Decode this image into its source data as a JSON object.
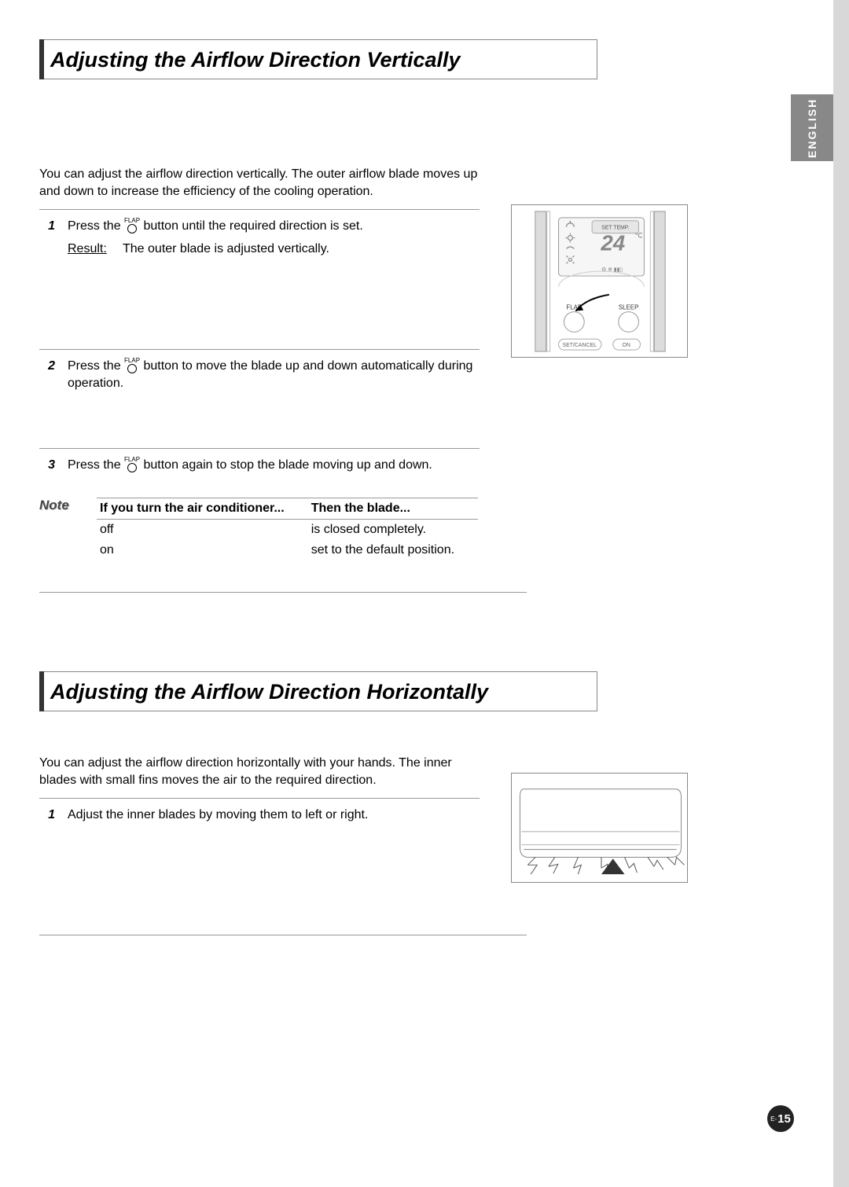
{
  "language_tab": "ENGLISH",
  "section1": {
    "title": "Adjusting the Airflow Direction Vertically",
    "intro": "You can adjust the airflow direction vertically. The outer airflow blade moves up and down to increase the efficiency of the cooling operation.",
    "steps": [
      {
        "num": "1",
        "pre": "Press the ",
        "icon": "FLAP",
        "post": " button until the required direction is set.",
        "result_label": "Result:",
        "result_text": "The outer blade is adjusted vertically."
      },
      {
        "num": "2",
        "pre": "Press the ",
        "icon": "FLAP",
        "post": " button to move the blade up and down automatically during operation."
      },
      {
        "num": "3",
        "pre": "Press the ",
        "icon": "FLAP",
        "post": " button again to stop the blade moving up and down."
      }
    ],
    "note": {
      "label": "Note",
      "head1": "If you turn the air conditioner...",
      "head2": "Then the blade...",
      "rows": [
        {
          "c1": "off",
          "c2": "is closed completely."
        },
        {
          "c1": "on",
          "c2": "set to the default position."
        }
      ]
    }
  },
  "section2": {
    "title": "Adjusting the Airflow Direction Horizontally",
    "intro": "You can adjust the airflow direction horizontally with your hands. The inner blades with small fins moves the air to the required direction.",
    "steps": [
      {
        "num": "1",
        "text": "Adjust the inner blades by moving them to left or right."
      }
    ]
  },
  "remote": {
    "set_temp": "SET TEMP.",
    "temp": "24",
    "unit": "℃",
    "flap": "FLAP",
    "sleep": "SLEEP",
    "set_cancel": "SET/CANCEL",
    "on": "ON"
  },
  "page_number": {
    "prefix": "E-",
    "num": "15"
  }
}
